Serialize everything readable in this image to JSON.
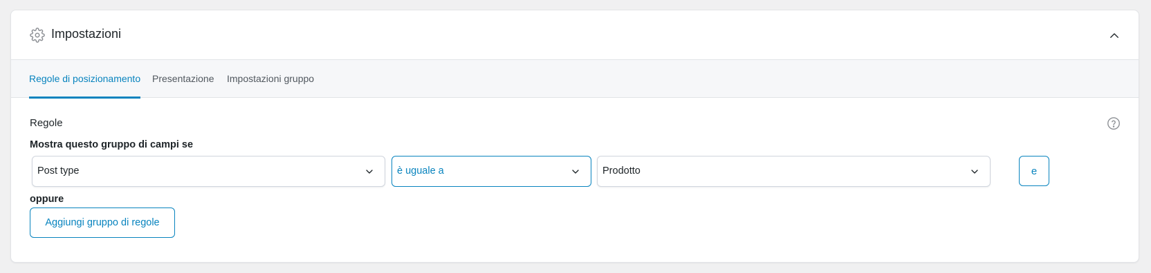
{
  "header": {
    "title": "Impostazioni",
    "icon": "gear-icon",
    "collapse_icon": "chevron-up-icon"
  },
  "tabs": [
    {
      "label": "Regole di posizionamento",
      "active": true
    },
    {
      "label": "Presentazione",
      "active": false
    },
    {
      "label": "Impostazioni gruppo",
      "active": false
    }
  ],
  "rules": {
    "section_label": "Regole",
    "show_label": "Mostra questo gruppo di campi se",
    "param_value": "Post type",
    "operator_value": "è uguale a",
    "value_value": "Prodotto",
    "and_label": "e",
    "or_label": "oppure",
    "add_group_label": "Aggiungi gruppo di regole",
    "help_icon": "help-circle-icon"
  },
  "colors": {
    "accent": "#0783be",
    "text": "#1d2327",
    "muted": "#50575e",
    "tabs_background": "#f6f7f9",
    "page_background": "#f0f0f1"
  }
}
